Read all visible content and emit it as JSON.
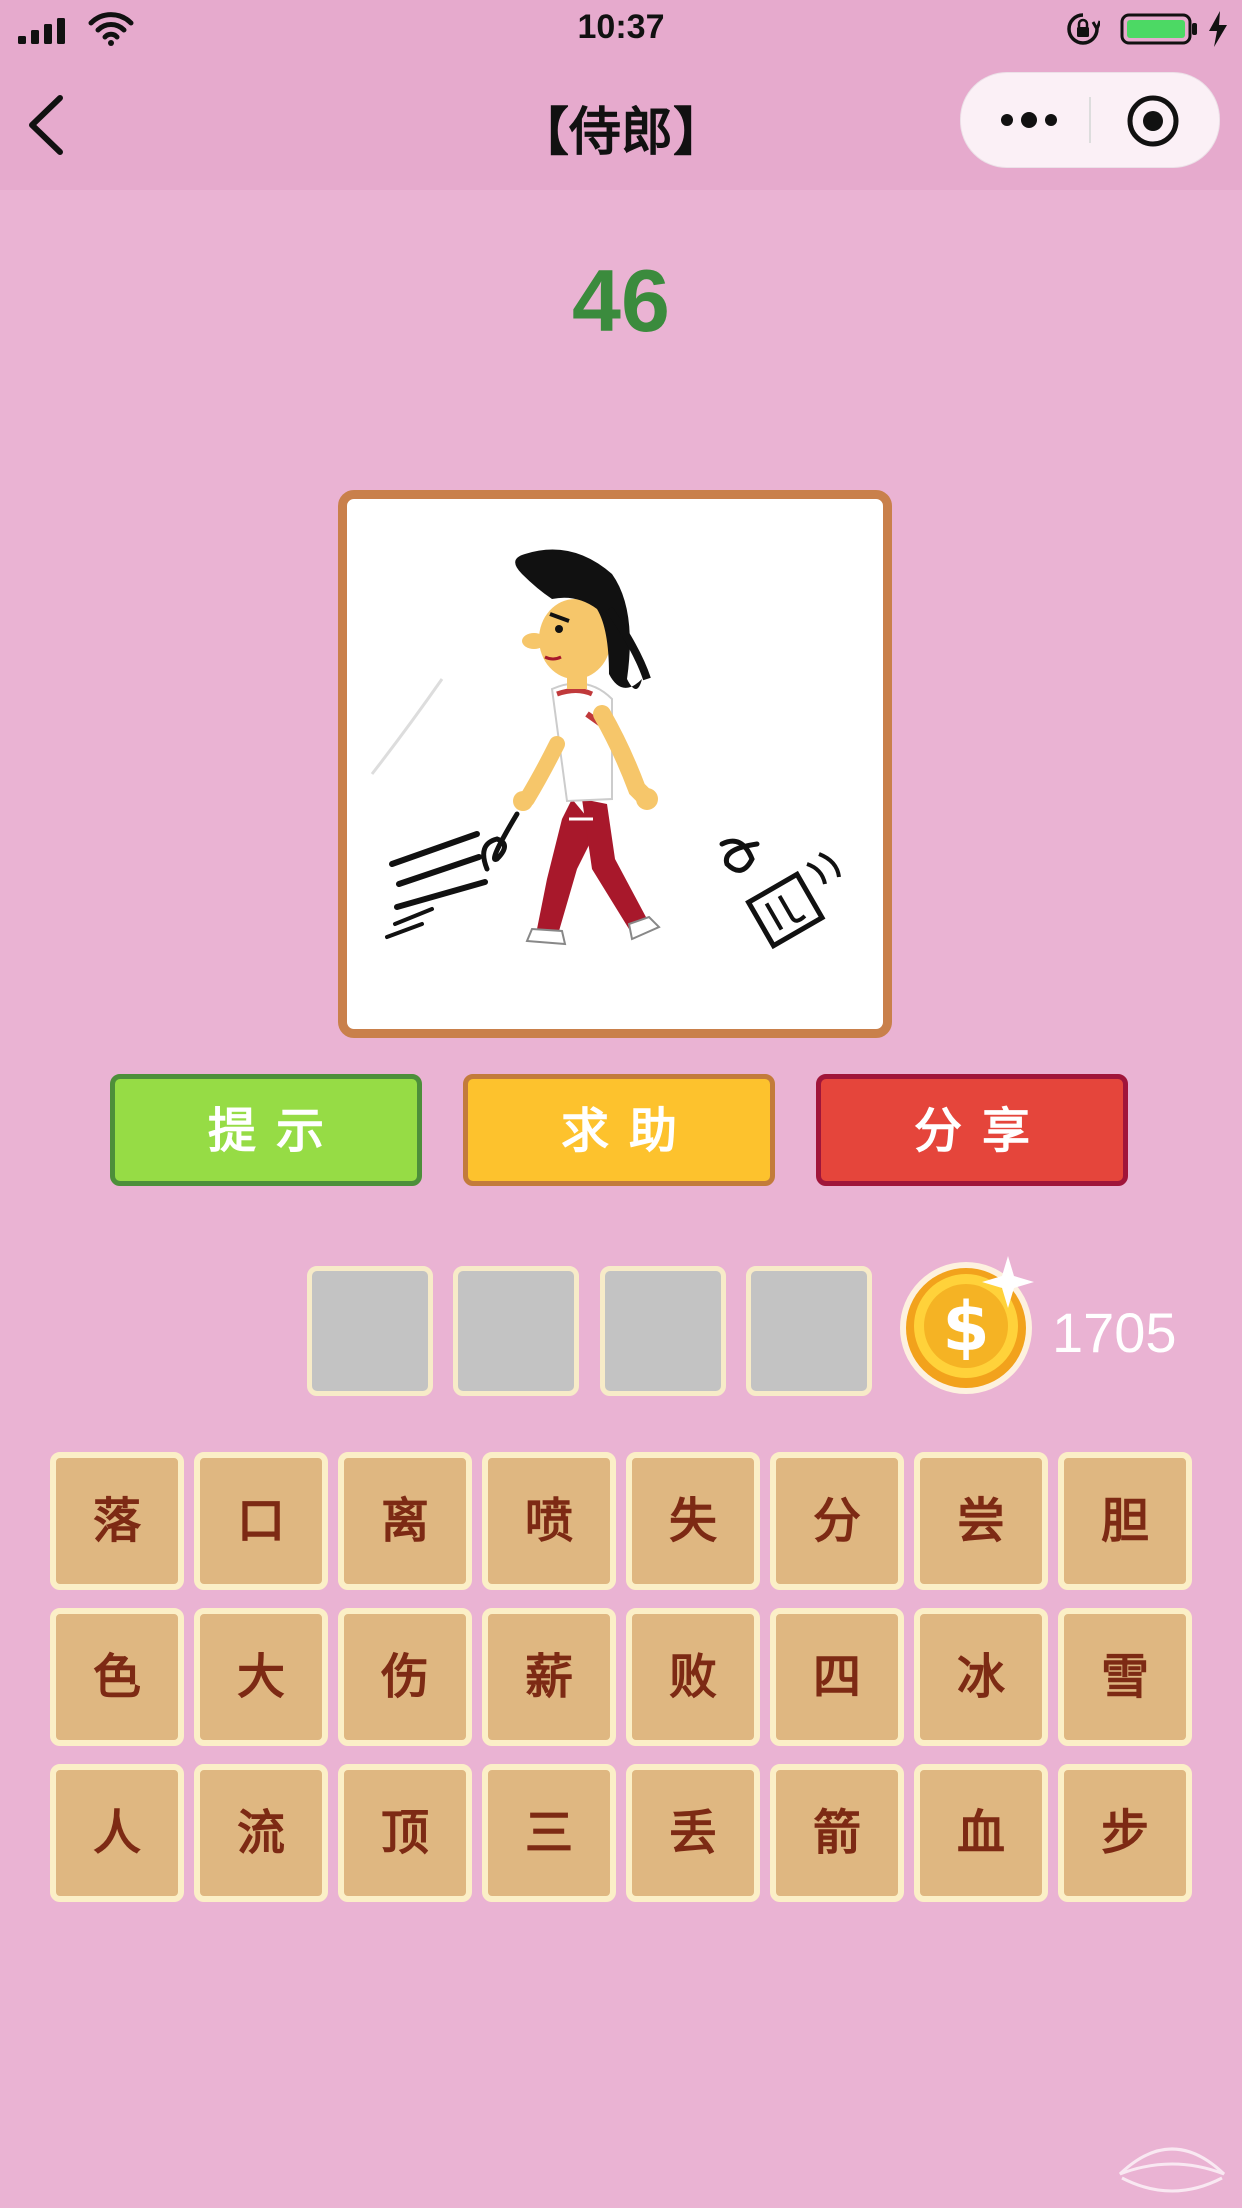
{
  "status_bar": {
    "time": "10:37"
  },
  "nav": {
    "title": "【侍郎】"
  },
  "level": {
    "number": "46"
  },
  "puzzle_image": {
    "icon": "walking-man-illustration"
  },
  "actions": {
    "hint": "提示",
    "help": "求助",
    "share": "分享"
  },
  "answer": {
    "slots": [
      "",
      "",
      "",
      ""
    ]
  },
  "coins": {
    "count": "1705"
  },
  "characters": [
    [
      "落",
      "口",
      "离",
      "喷",
      "失",
      "分",
      "尝",
      "胆"
    ],
    [
      "色",
      "大",
      "伤",
      "薪",
      "败",
      "四",
      "冰",
      "雪"
    ],
    [
      "人",
      "流",
      "顶",
      "三",
      "丢",
      "箭",
      "血",
      "步"
    ]
  ],
  "colors": {
    "background": "#eab3d3",
    "level_number": "#3b8b3d",
    "hint_button": "#96dc45",
    "help_button": "#fdc22d",
    "share_button": "#e5453b",
    "tile": "#dfb781",
    "tile_text": "#7d2a14"
  }
}
